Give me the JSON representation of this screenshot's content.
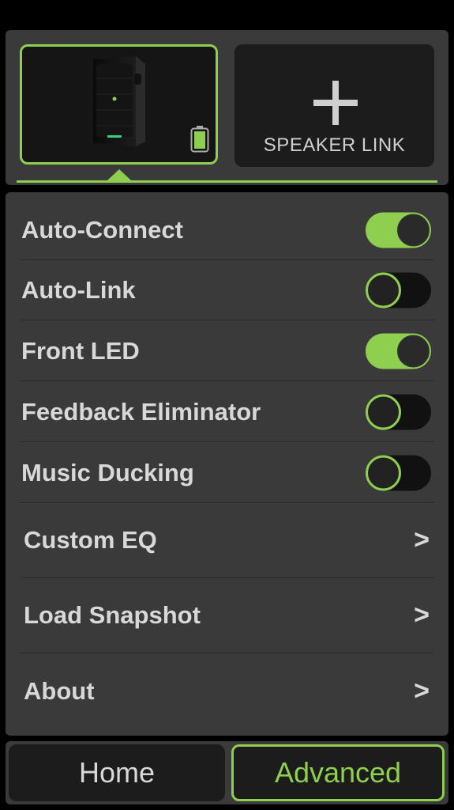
{
  "speakers": {
    "add_label": "SPEAKER LINK"
  },
  "settings": {
    "toggles": [
      {
        "label": "Auto-Connect",
        "on": true
      },
      {
        "label": "Auto-Link",
        "on": false
      },
      {
        "label": "Front LED",
        "on": true
      },
      {
        "label": "Feedback Eliminator",
        "on": false
      },
      {
        "label": "Music Ducking",
        "on": false
      }
    ],
    "nav": [
      {
        "label": "Custom EQ",
        "chevron": ">"
      },
      {
        "label": "Load Snapshot",
        "chevron": ">"
      },
      {
        "label": "About",
        "chevron": ">"
      }
    ]
  },
  "tabs": {
    "home": "Home",
    "advanced": "Advanced",
    "selected": "advanced"
  },
  "colors": {
    "accent": "#8fcf4f",
    "panel": "#3a3a3a",
    "background": "#000000"
  },
  "icons": {
    "speaker": "speaker-icon",
    "battery": "battery-icon",
    "add": "plus-icon"
  }
}
